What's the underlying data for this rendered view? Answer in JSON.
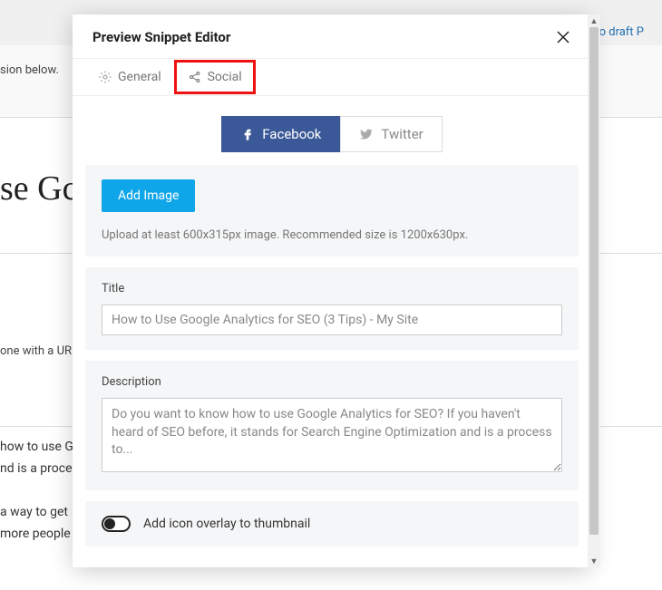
{
  "background": {
    "top_right_link": "to draft    P",
    "notice": "sion below.",
    "heading": "se Gc",
    "meta": "one with a UR",
    "para": "how to use G\nnd is a proce\n\na way to get\nmore people"
  },
  "modal": {
    "title": "Preview Snippet Editor",
    "tabs": {
      "general": "General",
      "social": "Social"
    },
    "sub_tabs": {
      "facebook": "Facebook",
      "twitter": "Twitter"
    },
    "image_panel": {
      "add_button": "Add Image",
      "hint": "Upload at least 600x315px image. Recommended size is 1200x630px."
    },
    "title_panel": {
      "label": "Title",
      "value": "How to Use Google Analytics for SEO (3 Tips) - My Site"
    },
    "desc_panel": {
      "label": "Description",
      "value": "Do you want to know how to use Google Analytics for SEO? If you haven't heard of SEO before, it stands for Search Engine Optimization and is a process to..."
    },
    "overlay_panel": {
      "label": "Add icon overlay to thumbnail"
    }
  }
}
